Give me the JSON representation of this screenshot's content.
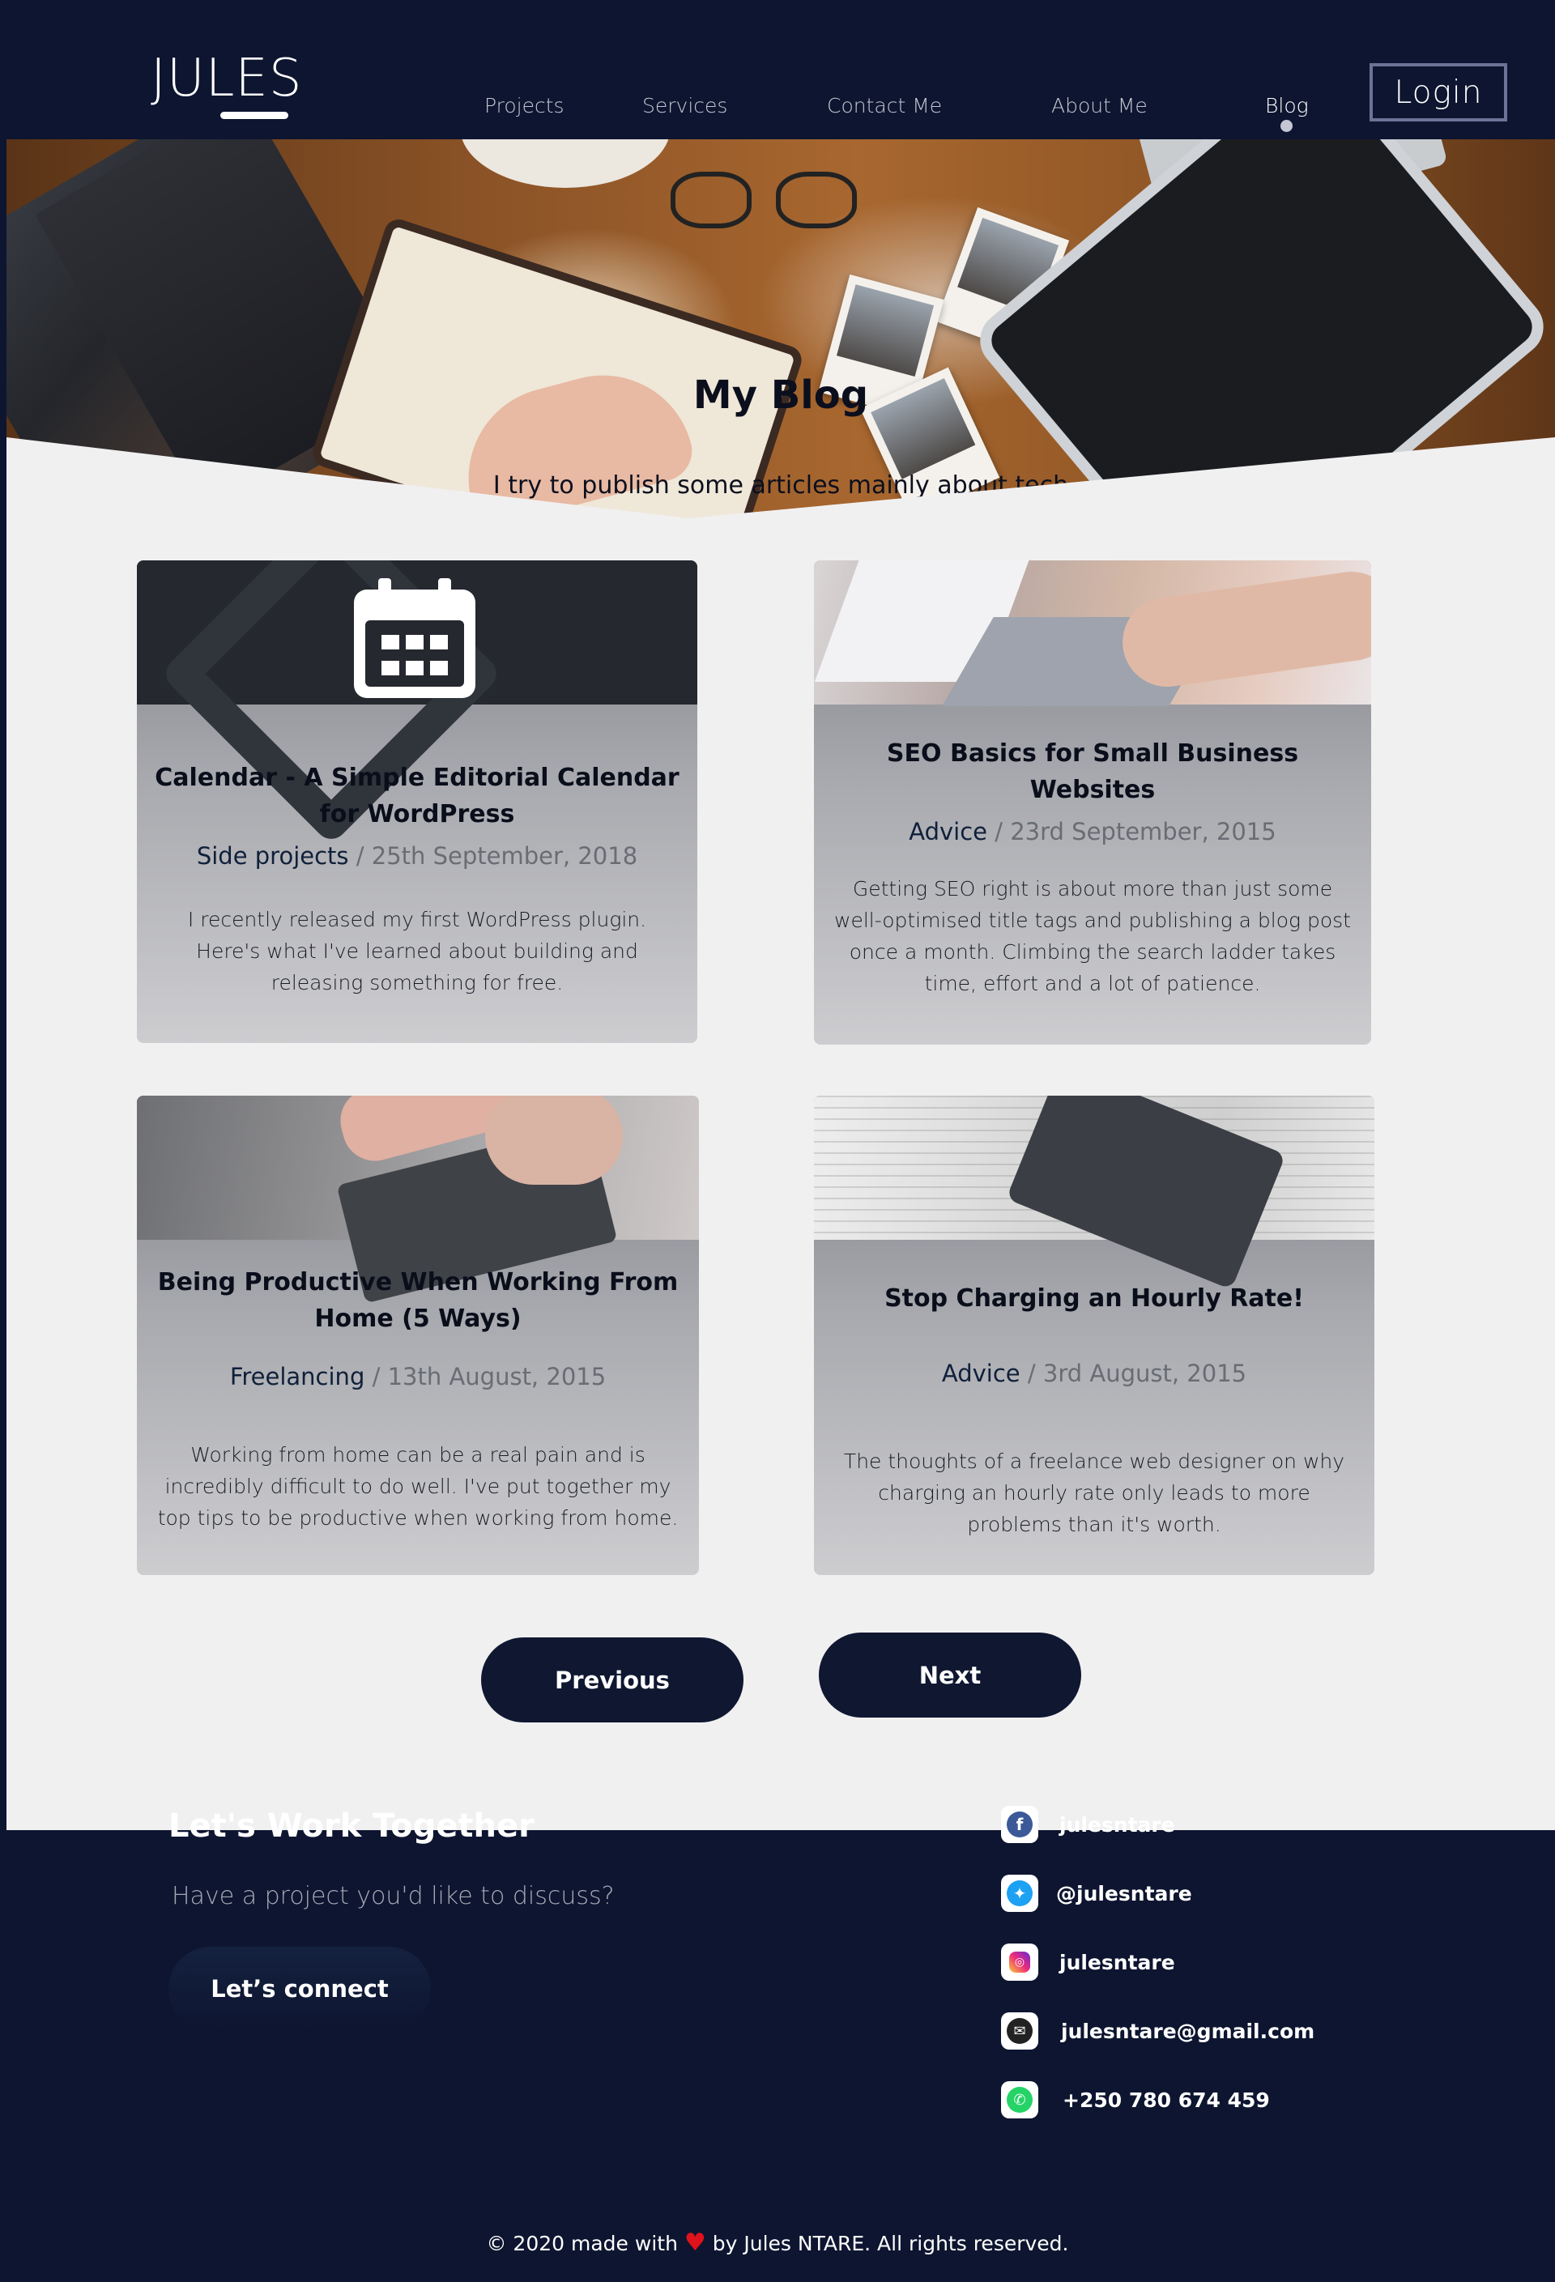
{
  "nav": {
    "logo": "JULES",
    "links": [
      "Projects",
      "Services",
      "Contact Me",
      "About Me",
      "Blog"
    ],
    "active": "Blog",
    "login": "Login"
  },
  "hero": {
    "title": "My Blog",
    "subtitle": "I try to publish some articles mainly about tech"
  },
  "posts": [
    {
      "title": "Calendar - A Simple Editorial Calendar for WordPress",
      "category": "Side projects",
      "date": "25th September, 2018",
      "excerpt": "I recently released my first WordPress plugin. Here's what I've learned about building and releasing something for free.",
      "image": "calendar-icon"
    },
    {
      "title": "SEO Basics for Small Business Websites",
      "category": "Advice",
      "date": "23rd September, 2015",
      "excerpt": "Getting SEO right is about more than just some well-optimised title tags and publishing a blog post once a month. Climbing the search ladder takes time, effort and a lot of patience.",
      "image": "laptop-photo"
    },
    {
      "title": "Being Productive When Working From Home (5 Ways)",
      "category": "Freelancing",
      "date": "13th August, 2015",
      "excerpt": "Working from home can be a real pain and is incredibly difficult to do well. I've put together my top tips to be productive when working from home.",
      "image": "typing-photo"
    },
    {
      "title": "Stop Charging an Hourly Rate!",
      "category": "Advice",
      "date": "3rd August, 2015",
      "excerpt": "The thoughts of a freelance web designer on why charging an hourly rate only leads to more problems than it's worth.",
      "image": "calculator-photo"
    }
  ],
  "meta_separator": "/",
  "pagination": {
    "previous": "Previous",
    "next": "Next"
  },
  "footer": {
    "title": "Let's Work Together",
    "subtitle": "Have a project you'd like to discuss?",
    "cta": "Let’s connect",
    "contacts": [
      {
        "icon": "facebook-icon",
        "label": "julesntare",
        "color": "#3b5998"
      },
      {
        "icon": "twitter-icon",
        "label": "@julesntare",
        "color": "#1da1f2"
      },
      {
        "icon": "instagram-icon",
        "label": "julesntare",
        "color": "#e1306c"
      },
      {
        "icon": "mail-icon",
        "label": "julesntare@gmail.com",
        "color": "#222222"
      },
      {
        "icon": "whatsapp-icon",
        "label": "+250 780 674 459",
        "color": "#25d366"
      }
    ],
    "copyright_before": "© 2020 made with",
    "copyright_after": "by Jules NTARE. All rights reserved."
  },
  "colors": {
    "navy": "#0d1530",
    "light_bg": "#f1f0f1",
    "button": "#0f1731",
    "heart": "#e0121b"
  }
}
